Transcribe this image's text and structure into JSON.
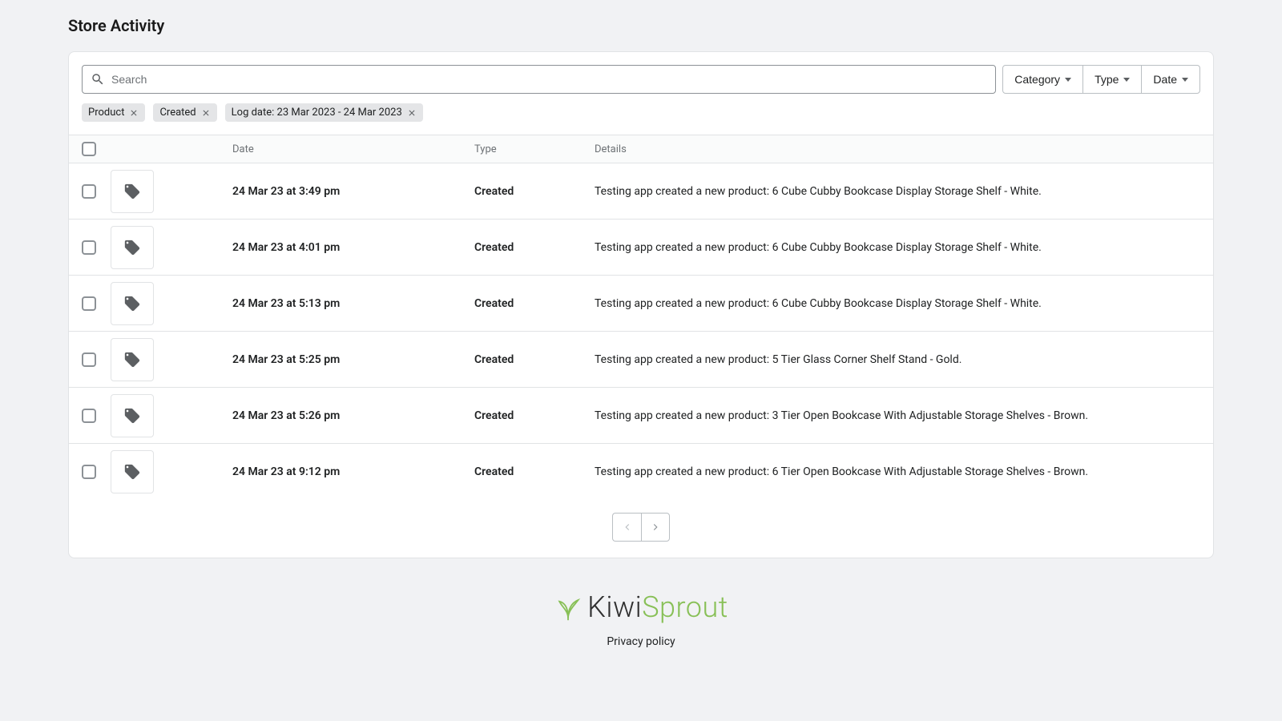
{
  "page": {
    "title": "Store Activity"
  },
  "search": {
    "placeholder": "Search",
    "value": ""
  },
  "filterButtons": [
    "Category",
    "Type",
    "Date"
  ],
  "chips": [
    "Product",
    "Created",
    "Log date: 23 Mar 2023 - 24 Mar 2023"
  ],
  "table": {
    "headers": {
      "date": "Date",
      "type": "Type",
      "details": "Details"
    },
    "rows": [
      {
        "date": "24 Mar 23 at 3:49 pm",
        "type": "Created",
        "details": "Testing app created a new product: 6 Cube Cubby Bookcase Display Storage Shelf - White."
      },
      {
        "date": "24 Mar 23 at 4:01 pm",
        "type": "Created",
        "details": "Testing app created a new product: 6 Cube Cubby Bookcase Display Storage Shelf - White."
      },
      {
        "date": "24 Mar 23 at 5:13 pm",
        "type": "Created",
        "details": "Testing app created a new product: 6 Cube Cubby Bookcase Display Storage Shelf - White."
      },
      {
        "date": "24 Mar 23 at 5:25 pm",
        "type": "Created",
        "details": "Testing app created a new product: 5 Tier Glass Corner Shelf Stand - Gold."
      },
      {
        "date": "24 Mar 23 at 5:26 pm",
        "type": "Created",
        "details": "Testing app created a new product: 3 Tier Open Bookcase With Adjustable Storage Shelves - Brown."
      },
      {
        "date": "24 Mar 23 at 9:12 pm",
        "type": "Created",
        "details": "Testing app created a new product: 6 Tier Open Bookcase With Adjustable Storage Shelves - Brown."
      }
    ]
  },
  "footer": {
    "brand_a": "Kiwi",
    "brand_b": "Sprout",
    "privacy": "Privacy policy"
  }
}
